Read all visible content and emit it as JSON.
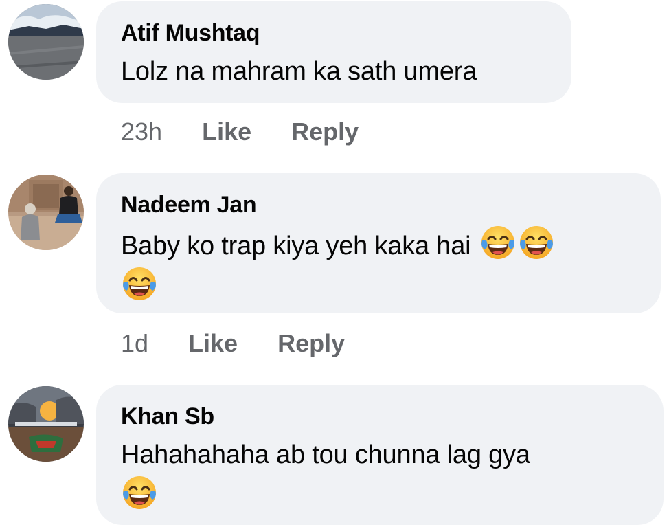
{
  "comments": [
    {
      "author": "Atif Mushtaq",
      "text": "Lolz na mahram ka sath umera",
      "emojis_line1": [],
      "emojis_line2": [],
      "time": "23h",
      "like_label": "Like",
      "reply_label": "Reply",
      "avatar_icon": "landscape-avatar"
    },
    {
      "author": "Nadeem Jan",
      "text": "Baby ko trap kiya yeh kaka hai",
      "emojis_line1": [
        "face-with-tears-of-joy",
        "face-with-tears-of-joy"
      ],
      "emojis_line2": [
        "face-with-tears-of-joy"
      ],
      "time": "1d",
      "like_label": "Like",
      "reply_label": "Reply",
      "avatar_icon": "people-avatar"
    },
    {
      "author": "Khan Sb",
      "text": "Hahahahaha ab tou chunna lag gya",
      "emojis_line1": [],
      "emojis_line2": [
        "face-with-tears-of-joy"
      ],
      "avatar_icon": "scene-avatar"
    }
  ],
  "colors": {
    "bubble": "#f0f2f5",
    "meta_text": "#65676b",
    "emoji_face": "#ffcc33",
    "tears": "#4a9be8"
  }
}
